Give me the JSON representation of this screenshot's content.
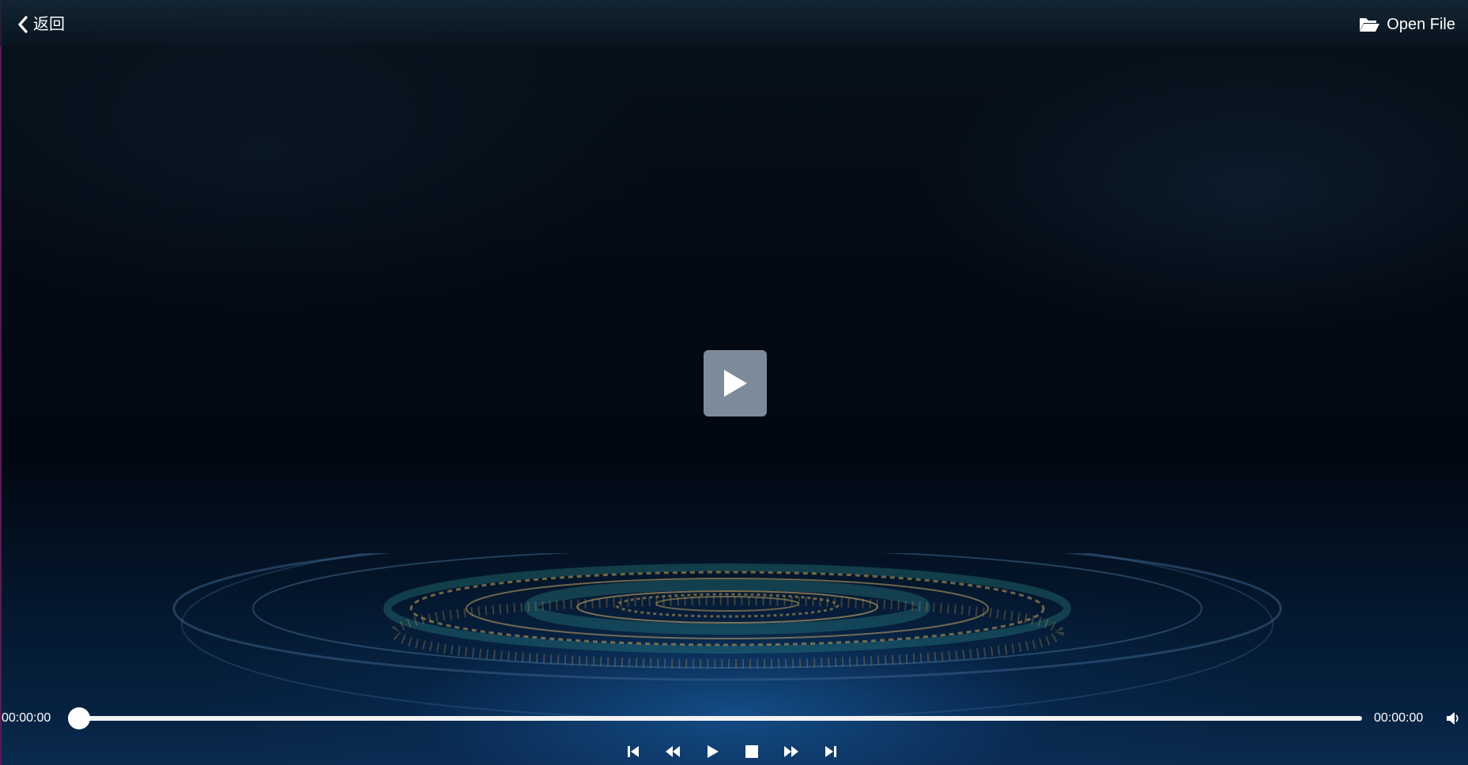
{
  "header": {
    "back_label": "返回",
    "open_file_label": "Open File"
  },
  "playback": {
    "current_time": "00:00:00",
    "total_time": "00:00:00",
    "progress": 0
  },
  "icons": {
    "back": "chevron-left-icon",
    "open_file": "folder-open-icon",
    "big_play": "play-icon",
    "volume": "volume-icon",
    "skip_previous": "skip-previous-icon",
    "rewind": "rewind-icon",
    "play": "play-icon",
    "stop": "stop-icon",
    "fast_forward": "fast-forward-icon",
    "skip_next": "skip-next-icon"
  },
  "colors": {
    "play_overlay": "#7d8a9a",
    "accent_glow": "#1e6ebe",
    "ring_gold": "#b89a5a",
    "ring_teal": "#2f8a8a"
  }
}
